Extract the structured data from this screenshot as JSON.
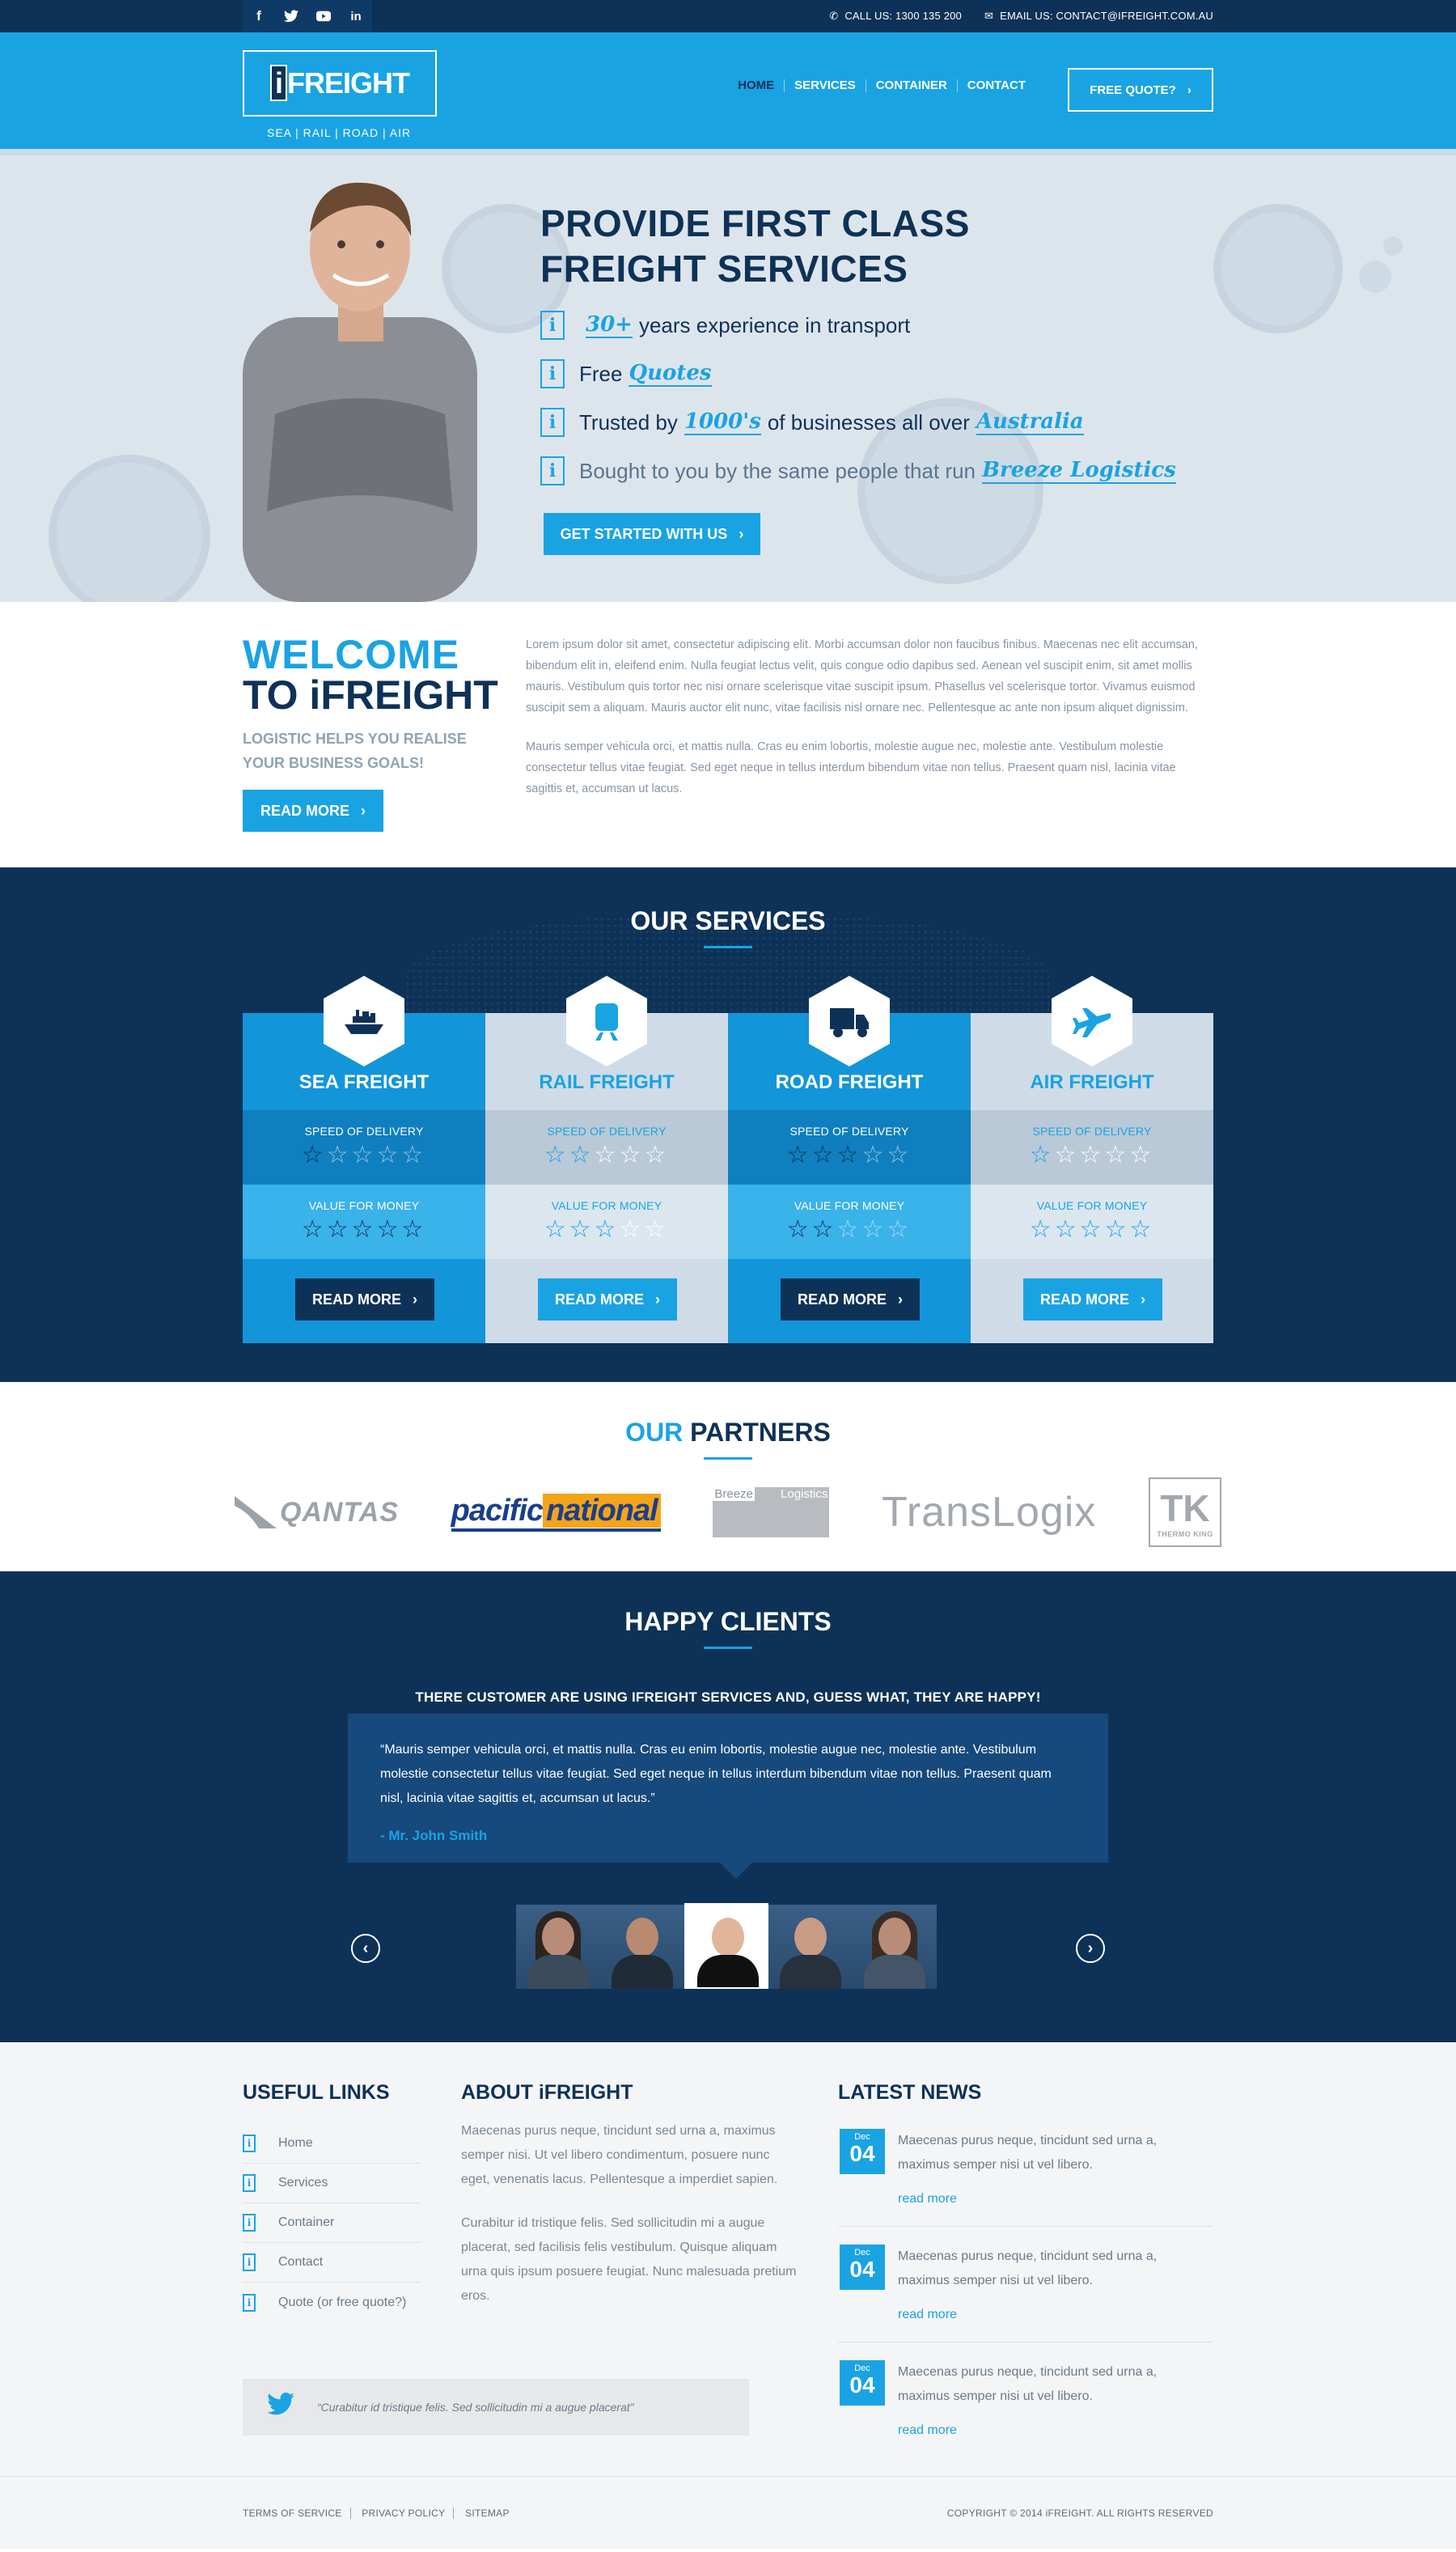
{
  "topbar": {
    "social": [
      "f",
      "t",
      "yt",
      "in"
    ],
    "call": "CALL US: 1300 135 200",
    "email": "EMAIL US: CONTACT@IFREIGHT.COM.AU"
  },
  "header": {
    "logo": "iFREIGHT",
    "logo_i": "i",
    "logo_rest": "FREIGHT",
    "tagline": "SEA | RAIL | ROAD | AIR",
    "nav": [
      "HOME",
      "SERVICES",
      "CONTAINER",
      "CONTACT"
    ],
    "cta": "FREE QUOTE?"
  },
  "hero": {
    "title_line1": "PROVIDE FIRST CLASS",
    "title_line2": "FREIGHT SERVICES",
    "bullet": "i",
    "item1_hl": "30+",
    "item1_text": "years experience in transport",
    "item2_text": "Free",
    "item2_hl": "Quotes",
    "item3_text1": "Trusted by",
    "item3_hl1": "1000's",
    "item3_text2": "of businesses all over",
    "item3_hl2": "Australia",
    "item4_text": "Bought to you by the same people that run",
    "item4_hl": "Breeze Logistics",
    "button": "GET STARTED WITH US"
  },
  "welcome": {
    "title1": "WELCOME",
    "title2": "TO iFREIGHT",
    "subtitle": "LOGISTIC HELPS YOU REALISE YOUR BUSINESS GOALS!",
    "button": "READ MORE",
    "para1": "Lorem ipsum dolor sit amet, consectetur adipiscing elit. Morbi accumsan dolor non faucibus finibus. Maecenas nec elit accumsan, bibendum elit in, eleifend enim. Nulla feugiat lectus velit, quis congue odio dapibus sed. Aenean vel suscipit enim, sit amet mollis mauris. Vestibulum quis tortor nec nisi ornare scelerisque vitae suscipit ipsum. Phasellus vel scelerisque tortor. Vivamus euismod suscipit sem a aliquam. Mauris auctor elit nunc, vitae facilisis nisl ornare nec. Pellentesque ac ante non ipsum aliquet dignissim.",
    "para2": "Mauris semper vehicula orci, et mattis nulla. Cras eu enim lobortis, molestie augue nec, molestie ante. Vestibulum molestie consectetur tellus vitae feugiat. Sed eget neque in tellus interdum bibendum vitae non tellus. Praesent quam nisl, lacinia vitae sagittis et, accumsan ut lacus."
  },
  "services": {
    "title": "OUR SERVICES",
    "speed_label": "SPEED OF DELIVERY",
    "value_label": "VALUE FOR MONEY",
    "button": "READ MORE",
    "items": [
      {
        "name": "SEA FREIGHT",
        "icon": "ship-icon",
        "speed": 1,
        "value": 5
      },
      {
        "name": "RAIL FREIGHT",
        "icon": "train-icon",
        "speed": 2,
        "value": 3
      },
      {
        "name": "ROAD FREIGHT",
        "icon": "truck-icon",
        "speed": 3,
        "value": 2
      },
      {
        "name": "AIR FREIGHT",
        "icon": "plane-icon",
        "speed": 1,
        "value": 5
      }
    ]
  },
  "partners": {
    "title_a": "OUR",
    "title_b": "PARTNERS",
    "qantas": "QANTAS",
    "pn_1": "pacific",
    "pn_2": "national",
    "breeze_1": "Breeze",
    "breeze_2": "Logistics",
    "translogix": "TransLogix",
    "tk_small": "THERMO KING"
  },
  "clients": {
    "title": "HAPPY CLIENTS",
    "subtitle": "THERE CUSTOMER ARE USING IFREIGHT SERVICES AND, GUESS WHAT, THEY ARE HAPPY!",
    "quote": "“Mauris semper vehicula orci, et mattis nulla. Cras eu enim lobortis, molestie augue nec, molestie ante. Vestibulum molestie consectetur tellus vitae feugiat. Sed eget neque in tellus interdum bibendum vitae non tellus. Praesent quam nisl, lacinia vitae sagittis et, accumsan ut lacus.”",
    "author": "- Mr. John Smith",
    "prev": "‹",
    "next": "›"
  },
  "footer": {
    "links_title": "USEFUL LINKS",
    "links": [
      "Home",
      "Services",
      "Container",
      "Contact",
      "Quote (or free quote?)"
    ],
    "about_title": "ABOUT iFREIGHT",
    "about_p1": "Maecenas purus neque, tincidunt sed urna a, maximus semper nisi. Ut vel libero condimentum, posuere nunc eget, venenatis lacus. Pellentesque a imperdiet sapien.",
    "about_p2": "Curabitur id tristique felis. Sed sollicitudin mi a augue placerat, sed facilisis felis vestibulum. Quisque aliquam urna quis ipsum posuere feugiat. Nunc malesuada pretium eros.",
    "news_title": "LATEST NEWS",
    "news": [
      {
        "month": "Dec",
        "day": "04",
        "text": "Maecenas purus neque, tincidunt sed urna a, maximus semper nisi ut vel libero.",
        "more": "read more"
      },
      {
        "month": "Dec",
        "day": "04",
        "text": "Maecenas purus neque, tincidunt sed urna a, maximus semper nisi ut vel libero.",
        "more": "read more"
      },
      {
        "month": "Dec",
        "day": "04",
        "text": "Maecenas purus neque, tincidunt sed urna a, maximus semper nisi ut vel libero.",
        "more": "read more"
      }
    ],
    "tweet": "“Curabitur id tristique felis. Sed sollicitudin mi a augue placerat”"
  },
  "bottom": {
    "links": [
      "TERMS OF SERVICE",
      "PRIVACY POLICY",
      "SITEMAP"
    ],
    "copyright": "COPYRIGHT © 2014 iFREIGHT. ALL RIGHTS RESERVED"
  },
  "colors": {
    "navy": "#0e3257",
    "blue": "#1aa3e3",
    "light": "#dde5ec"
  }
}
